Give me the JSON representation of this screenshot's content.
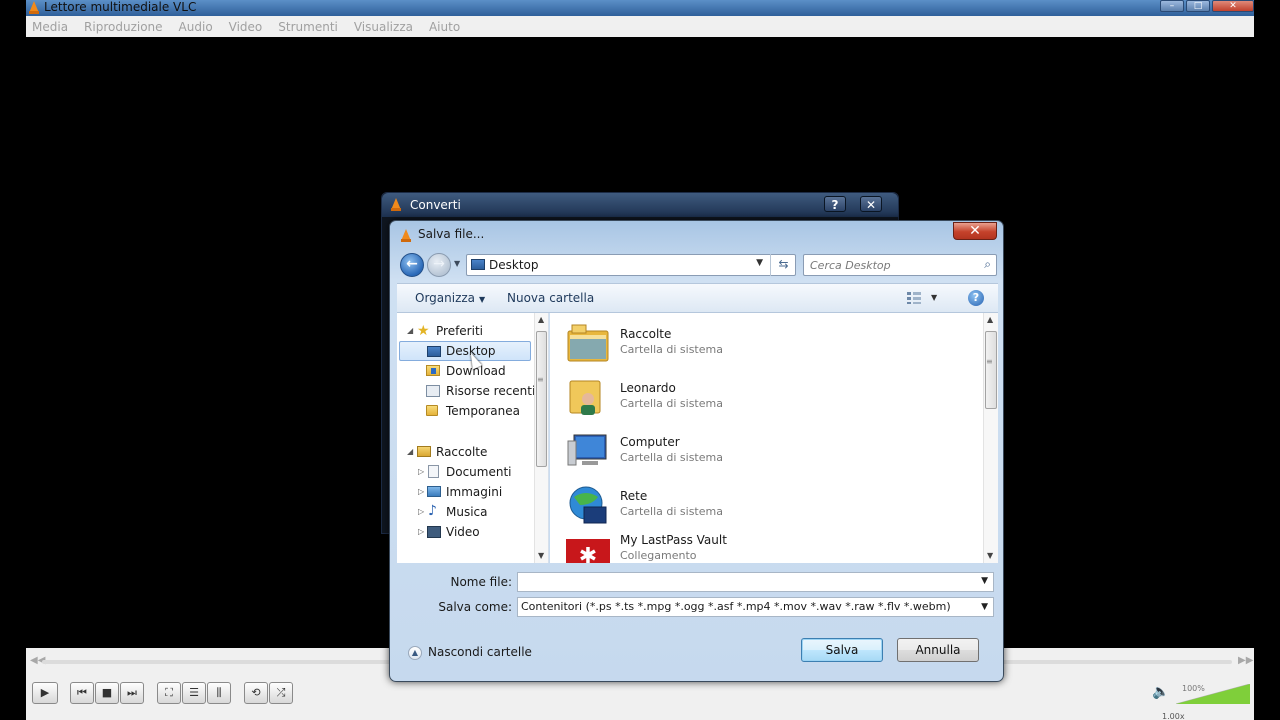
{
  "vlc": {
    "title": "Lettore multimediale VLC",
    "menu": [
      "Media",
      "Riproduzione",
      "Audio",
      "Video",
      "Strumenti",
      "Visualizza",
      "Aiuto"
    ],
    "volume_percent": "100%",
    "speed": "1.00x",
    "volume_level": 1.0
  },
  "converti": {
    "title": "Converti",
    "help_label": "?",
    "close_label": "✕"
  },
  "dialog": {
    "title": "Salva file...",
    "close_label": "✕",
    "address": "Desktop",
    "search_placeholder": "Cerca Desktop",
    "toolbar": {
      "organize": "Organizza",
      "new_folder": "Nuova cartella"
    },
    "nav": {
      "favorites": "Preferiti",
      "fav_items": [
        "Desktop",
        "Download",
        "Risorse recenti",
        "Temporanea"
      ],
      "libraries": "Raccolte",
      "lib_items": [
        "Documenti",
        "Immagini",
        "Musica",
        "Video"
      ]
    },
    "files": [
      {
        "name": "Raccolte",
        "type": "Cartella di sistema",
        "icon": "libraries-icon"
      },
      {
        "name": "Leonardo",
        "type": "Cartella di sistema",
        "icon": "user-folder-icon"
      },
      {
        "name": "Computer",
        "type": "Cartella di sistema",
        "icon": "computer-icon"
      },
      {
        "name": "Rete",
        "type": "Cartella di sistema",
        "icon": "network-icon"
      },
      {
        "name": "My LastPass Vault",
        "type": "Collegamento",
        "icon": "lastpass-icon"
      }
    ],
    "filename_label": "Nome file:",
    "filename_value": "",
    "savetype_label": "Salva come:",
    "savetype_value": "Contenitori (*.ps *.ts *.mpg *.ogg *.asf *.mp4 *.mov *.wav *.raw *.flv *.webm)",
    "hide_folders": "Nascondi cartelle",
    "save_button": "Salva",
    "cancel_button": "Annulla"
  },
  "colors": {
    "selection": "#cfe4fa",
    "dialog_chrome": "#c6d9ee",
    "primary_button": "#bee6fd",
    "close_red": "#c5422b"
  }
}
